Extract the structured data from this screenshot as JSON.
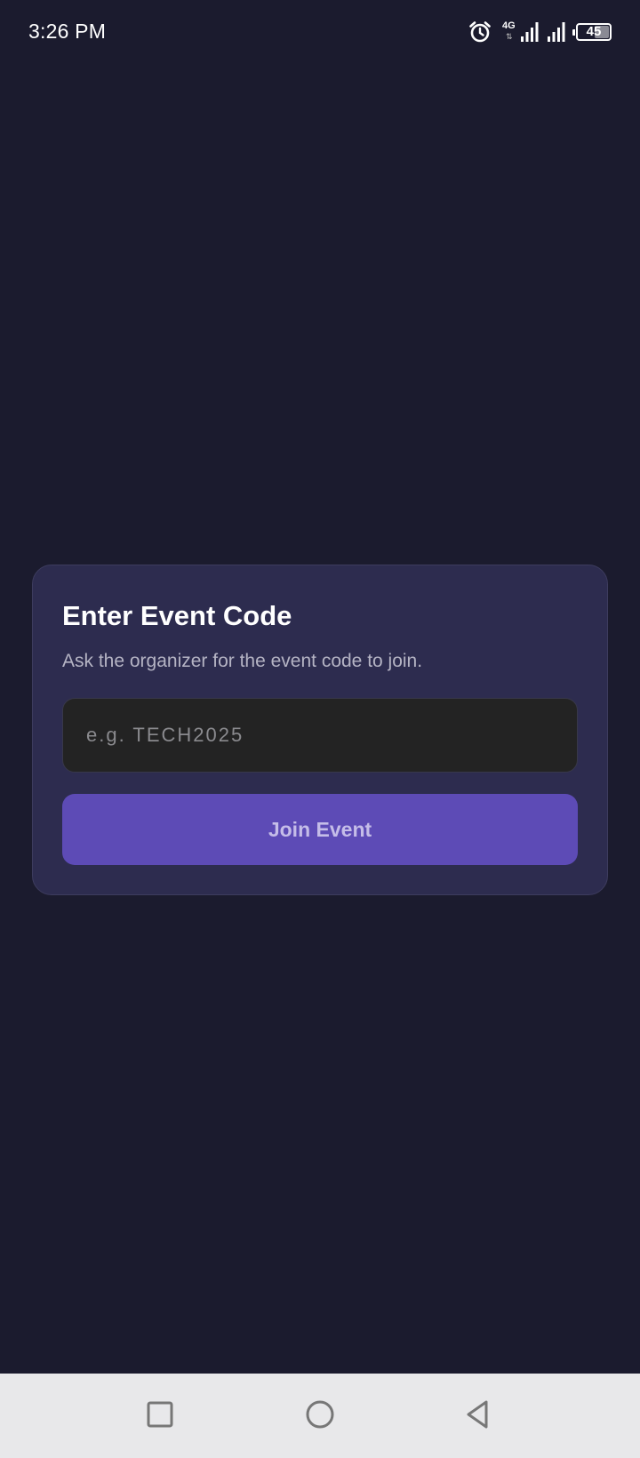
{
  "status_bar": {
    "time": "3:26 PM",
    "network_label": "4G",
    "network_arrows": "⇅",
    "battery_level": "45",
    "battery_fraction": 0.45,
    "icons": [
      "alarm-icon",
      "signal-strength-icon",
      "signal-strength-icon",
      "battery-icon"
    ]
  },
  "card": {
    "title": "Enter Event Code",
    "subtitle": "Ask the organizer for the event code to join.",
    "input_value": "",
    "input_placeholder": "e.g. TECH2025",
    "button_label": "Join Event"
  },
  "nav_bar": {
    "buttons": [
      "recent-apps-icon",
      "home-icon",
      "back-icon"
    ]
  },
  "colors": {
    "background": "#1b1b2e",
    "card": "#2d2c4f",
    "input": "#232323",
    "button": "#5d4bb6",
    "button_text": "#c5bde8",
    "nav_bar": "#e8e8ea"
  }
}
